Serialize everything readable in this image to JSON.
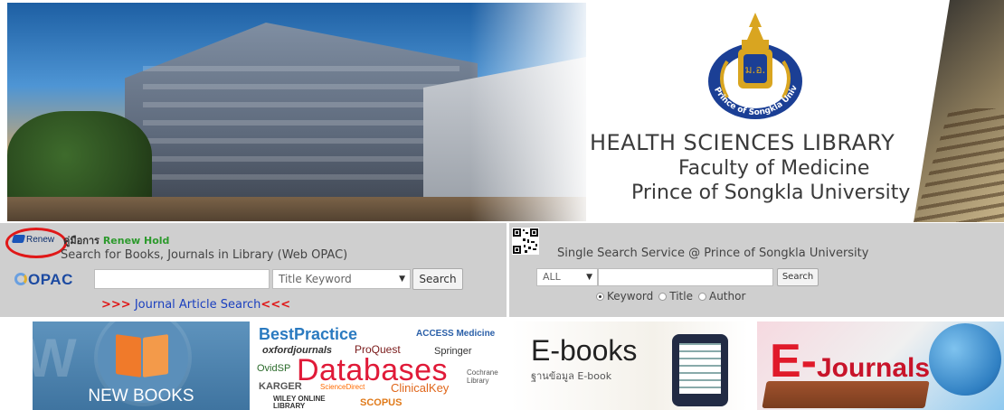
{
  "banner": {
    "seal_text": "Prince of Songkla University",
    "title_line1": "HEALTH SCIENCES LIBRARY",
    "title_line2": "Faculty of Medicine",
    "title_line3": "Prince of Songkla University"
  },
  "opac_panel": {
    "renew_logo_label": "Renew",
    "renew_manual_prefix": "คู่มือการ",
    "renew_manual_link": "Renew Hold",
    "description": "Search for Books, Journals in Library (Web OPAC)",
    "logo_label": "OPAC",
    "search_input_value": "",
    "search_type_selected": "Title Keyword",
    "search_button_label": "Search",
    "journal_link_prefix": ">>>",
    "journal_link_text": " Journal Article Search",
    "journal_link_suffix": "<<<"
  },
  "single_search_panel": {
    "title": "Single Search Service @ Prince of Songkla University",
    "scope_selected": "ALL",
    "search_input_value": "",
    "search_button_label": "Search",
    "radio_options": [
      "Keyword",
      "Title",
      "Author"
    ],
    "radio_selected": "Keyword"
  },
  "tiles": {
    "new_books": {
      "label": "NEW BOOKS",
      "watermark": "W"
    },
    "databases": {
      "bestpractice": "BestPractice",
      "accessmedicine": "ACCESS Medicine",
      "oxford": "oxfordjournals",
      "proquest": "ProQuest",
      "springer": "Springer",
      "ovid": "OvidSP",
      "database": "Databases",
      "cochrane": "Cochrane Library",
      "karger": "KARGER",
      "sciencedirect": "ScienceDirect",
      "clinicalkey": "ClinicalKey",
      "wiley": "WILEY ONLINE LIBRARY",
      "scopus": "SCOPUS"
    },
    "ebooks": {
      "title": "E-books",
      "subtitle": "ฐานข้อมูล E-book"
    },
    "ejournals": {
      "letter_e": "E-",
      "rest": "Journals"
    }
  },
  "colors": {
    "panel_bg": "#cfcfcf",
    "link_blue": "#1a3fbf",
    "accent_red": "#e01818",
    "renew_green": "#2d9a2d"
  }
}
